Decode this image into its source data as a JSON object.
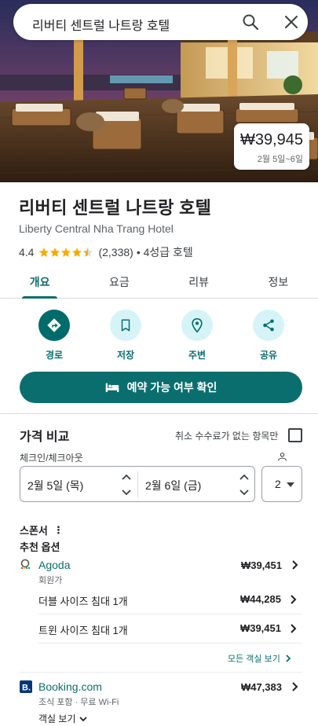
{
  "search": {
    "query": "리버티 센트럴 나트랑 호텔"
  },
  "hero_price": {
    "amount": "₩39,945",
    "dates": "2월 5일~6일"
  },
  "hotel": {
    "name": "리버티 센트럴 나트랑 호텔",
    "name_en": "Liberty Central Nha Trang Hotel",
    "rating": "4.4",
    "stars_shown": 4.5,
    "reviews": "(2,338)",
    "class": "• 4성급 호텔"
  },
  "tabs": [
    {
      "label": "개요",
      "active": true
    },
    {
      "label": "요금",
      "active": false
    },
    {
      "label": "리뷰",
      "active": false
    },
    {
      "label": "정보",
      "active": false
    }
  ],
  "actions": [
    {
      "label": "경로",
      "icon": "directions-icon"
    },
    {
      "label": "저장",
      "icon": "bookmark-icon"
    },
    {
      "label": "주변",
      "icon": "nearby-icon"
    },
    {
      "label": "공유",
      "icon": "share-icon"
    }
  ],
  "book_button": {
    "label": "예약 가능 여부 확인"
  },
  "price_compare": {
    "title": "가격 비교",
    "free_cancel_label": "취소 수수료가 없는 항목만",
    "checkin_label": "체크인/체크아웃",
    "checkin": "2월 5일 (목)",
    "checkout": "2월 6일 (금)",
    "guests": "2",
    "sponsor_label": "스폰서",
    "reco_label": "추천 옵션"
  },
  "providers": {
    "agoda": {
      "name": "Agoda",
      "sub": "회원가",
      "price": "₩39,451",
      "rooms": [
        {
          "name": "더블 사이즈 침대 1개",
          "price": "₩44,285"
        },
        {
          "name": "트윈 사이즈 침대 1개",
          "price": "₩39,451"
        }
      ],
      "all_rooms": "모든 객실 보기"
    },
    "booking": {
      "name": "Booking.com",
      "sub": "조식 포함 · 무료 Wi-Fi",
      "price": "₩47,383",
      "see_rooms": "객실 보기"
    }
  },
  "colors": {
    "accent": "#0b6e6e",
    "accent_light": "#d6f4f8",
    "star": "#f9ab00"
  }
}
